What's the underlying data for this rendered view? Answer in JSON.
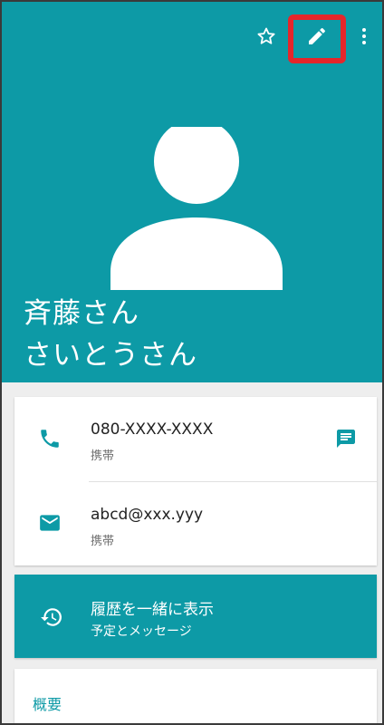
{
  "colors": {
    "accent": "#0d9aa6",
    "highlight": "#e5262b"
  },
  "header": {
    "name": "斉藤さん",
    "name_reading": "さいとうさん",
    "icons": [
      "star-outline-icon",
      "edit-pencil-icon",
      "more-vert-icon"
    ]
  },
  "contact": {
    "phone": {
      "number": "080-XXXX-XXXX",
      "type": "携帯",
      "icon": "phone-icon",
      "action_icon": "message-icon"
    },
    "email": {
      "address": "abcd@xxx.yyy",
      "type": "携帯",
      "icon": "email-icon"
    }
  },
  "history": {
    "title": "履歴を一緒に表示",
    "subtitle": "予定とメッセージ",
    "icon": "history-icon"
  },
  "summary": {
    "label": "概要"
  }
}
